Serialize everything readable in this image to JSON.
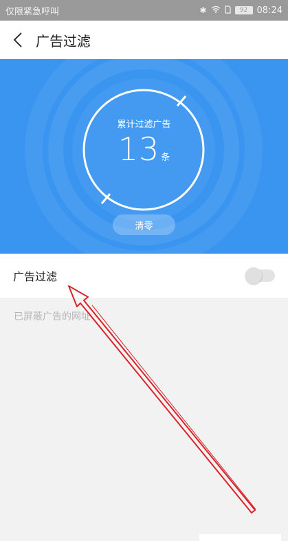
{
  "status_bar": {
    "carrier": "仅限紧急呼叫",
    "battery": "92",
    "time": "08:24",
    "icons": [
      "bluetooth-icon",
      "wifi-icon",
      "sim-icon",
      "battery-icon"
    ]
  },
  "header": {
    "title": "广告过滤",
    "back_icon": "chevron-left-icon"
  },
  "counter": {
    "label": "累计过滤广告",
    "value": "13",
    "unit": "条",
    "clear_button": "清零"
  },
  "filter": {
    "label": "广告过滤",
    "enabled": false
  },
  "blocked_section": {
    "hint": "已屏蔽广告的网址"
  },
  "colors": {
    "hero": "#3a95f0",
    "annotation": "#d9242a"
  }
}
